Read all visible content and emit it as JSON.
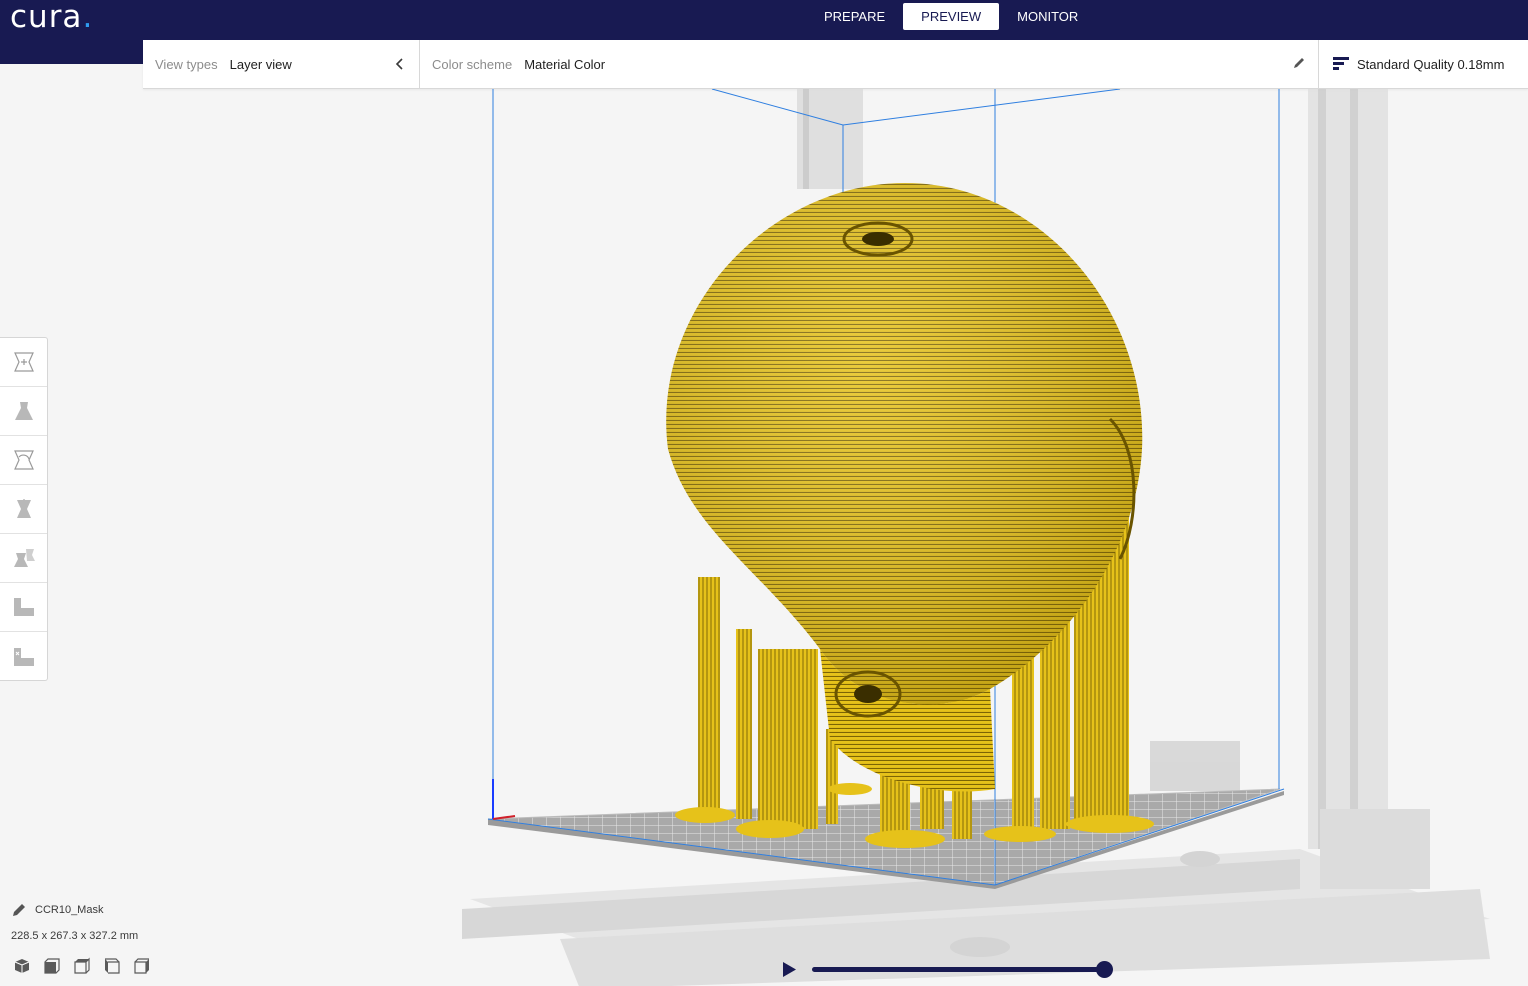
{
  "app": {
    "logo_text": "cura",
    "logo_dot": "."
  },
  "stages": [
    {
      "label": "PREPARE",
      "active": false
    },
    {
      "label": "PREVIEW",
      "active": true
    },
    {
      "label": "MONITOR",
      "active": false
    }
  ],
  "header": {
    "view_types_label": "View types",
    "view_types_value": "Layer view",
    "color_scheme_label": "Color scheme",
    "color_scheme_value": "Material Color",
    "quality": "Standard Quality 0.18mm"
  },
  "tools": [
    {
      "name": "move-tool",
      "icon": "move-icon"
    },
    {
      "name": "scale-tool",
      "icon": "scale-icon"
    },
    {
      "name": "rotate-tool",
      "icon": "rotate-icon"
    },
    {
      "name": "mirror-tool",
      "icon": "mirror-icon"
    },
    {
      "name": "per-model-settings-tool",
      "icon": "per-model-settings-icon"
    },
    {
      "name": "support-blocker-tool",
      "icon": "support-blocker-icon"
    },
    {
      "name": "custom-supports-tool",
      "icon": "custom-supports-icon"
    }
  ],
  "object": {
    "name": "CCR10_Mask",
    "dimensions": "228.5 x 267.3 x 327.2 mm"
  },
  "camera_views": [
    "3d-view-icon",
    "front-view-icon",
    "top-view-icon",
    "left-view-icon",
    "right-view-icon"
  ],
  "layer_slider": {
    "current_fraction": 1.0
  },
  "colors": {
    "brand": "#181a52",
    "accent": "#2f9cf0",
    "material": "#e6c21a"
  }
}
